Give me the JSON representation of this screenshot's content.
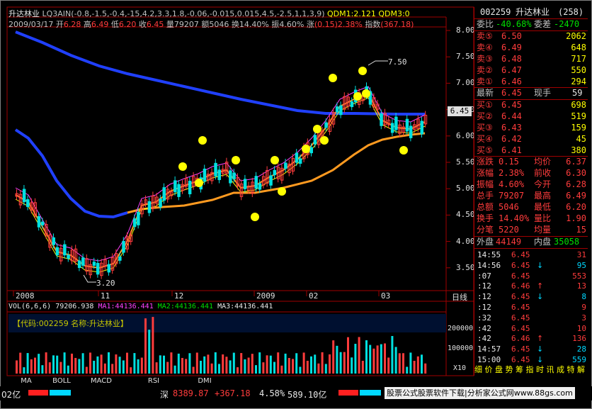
{
  "header": {
    "stock_name": "升达林业",
    "indicator": "LQ3AIN(-0.8,-1.5,-0.4,-15,4.2,3.3,1.8,-0.06,-0.015,0.015,4.5,-2.5,1,1,3,9)",
    "qdm1": "QDM1:2.121",
    "qdm3": "QDM3:0",
    "date": "2009/03/17",
    "open_l": "开",
    "open_v": "6.28",
    "high_l": "高",
    "high_v": "6.49",
    "low_l": "低",
    "low_v": "6.20",
    "close_l": "收",
    "close_v": "6.45",
    "vol_l": "量",
    "vol_v": "79207",
    "amt_l": "额",
    "amt_v": "5046",
    "turn_l": "换",
    "turn_v": "14.40%",
    "amp_l": "振",
    "amp_v": "4.60%",
    "chg_l": "涨",
    "chg_v": "(0.15)2.38%",
    "idx_l": "指数",
    "idx_v": "(367.18)"
  },
  "price_axis": [
    "8.00",
    "7.50",
    "7.00",
    "6.50",
    "6.00",
    "5.50",
    "5.00",
    "4.50",
    "4.00",
    "3.50"
  ],
  "current_price_tag": "6.45",
  "annotations": {
    "high_label": "7.50",
    "low_label": "3.20"
  },
  "time_axis": {
    "labels": [
      "2008",
      "11",
      "12",
      "2009",
      "02",
      "03"
    ],
    "right_label": "日线"
  },
  "volume": {
    "header": "VOL(6,6,6) 79206.938",
    "ma1": "MA1:44136.441",
    "ma2": "MA2:44136.441",
    "ma3": "MA3:44136.441",
    "info_box": "【代码:002259 名称:升达林业】",
    "axis": [
      "200000",
      "100000"
    ],
    "unit": "X10"
  },
  "tabs": [
    "MA",
    "BOLL",
    "MACD",
    "RSI",
    "DMI"
  ],
  "bottom": {
    "left_stub": "02亿",
    "market_label": "深",
    "index_value": "8389.87",
    "index_change": "+367.18",
    "index_pct": "4.58%",
    "index_amount": "589.10亿",
    "ad_text": "股票公式股票软件下载|分析家公式网www.88gs.com"
  },
  "panel": {
    "code": "002259",
    "name": "升达林业",
    "num": "(258)",
    "weibi_l": "委比",
    "weibi_v": "-40.68%",
    "weicha_l": "委差",
    "weicha_v": "-2470",
    "sells": [
      {
        "label": "卖⑤",
        "price": "6.50",
        "vol": "2062"
      },
      {
        "label": "卖④",
        "price": "6.49",
        "vol": "648"
      },
      {
        "label": "卖③",
        "price": "6.48",
        "vol": "717"
      },
      {
        "label": "卖②",
        "price": "6.47",
        "vol": "550"
      },
      {
        "label": "卖①",
        "price": "6.46",
        "vol": "294"
      }
    ],
    "latest_l": "最新",
    "latest_v": "6.45",
    "xianshou_l": "现手",
    "xianshou_v": "59",
    "buys": [
      {
        "label": "买①",
        "price": "6.45",
        "vol": "698"
      },
      {
        "label": "买②",
        "price": "6.44",
        "vol": "519"
      },
      {
        "label": "买③",
        "price": "6.43",
        "vol": "159"
      },
      {
        "label": "买④",
        "price": "6.42",
        "vol": "45"
      },
      {
        "label": "买⑤",
        "price": "6.41",
        "vol": "380"
      }
    ],
    "stats": [
      {
        "l1": "涨跌",
        "v1": "0.15",
        "l2": "均价",
        "v2": "6.37"
      },
      {
        "l1": "涨幅",
        "v1": "2.38%",
        "l2": "前收",
        "v2": "6.30"
      },
      {
        "l1": "振幅",
        "v1": "4.60%",
        "l2": "今开",
        "v2": "6.28"
      },
      {
        "l1": "总手",
        "v1": "79207",
        "l2": "最高",
        "v2": "6.49"
      },
      {
        "l1": "总额",
        "v1": "5046",
        "l2": "最低",
        "v2": "6.20"
      },
      {
        "l1": "换手",
        "v1": "14.40%",
        "l2": "量比",
        "v2": "1.90"
      },
      {
        "l1": "分笔",
        "v1": "5220",
        "l2": "均量",
        "v2": "15"
      }
    ],
    "waipan_l": "外盘",
    "waipan_v": "44149",
    "neipan_l": "内盘",
    "neipan_v": "35058",
    "ticks": [
      {
        "t": "14:55",
        "p": "6.45",
        "a": "",
        "v": "31"
      },
      {
        "t": "14:56",
        "p": "6.45",
        "a": "↓",
        "v": "95"
      },
      {
        "t": ":07",
        "p": "6.45",
        "a": "",
        "v": "553"
      },
      {
        "t": ":12",
        "p": "6.46",
        "a": "↑",
        "v": "13"
      },
      {
        "t": ":12",
        "p": "6.45",
        "a": "↓",
        "v": "8"
      },
      {
        "t": ":12",
        "p": "6.45",
        "a": "",
        "v": "9"
      },
      {
        "t": ":32",
        "p": "6.45",
        "a": "",
        "v": "3"
      },
      {
        "t": ":42",
        "p": "6.45",
        "a": "",
        "v": "10"
      },
      {
        "t": ":42",
        "p": "6.46",
        "a": "↑",
        "v": "136"
      },
      {
        "t": "14:57",
        "p": "6.45",
        "a": "↓",
        "v": "28"
      },
      {
        "t": "15:00",
        "p": "6.45",
        "a": "↓",
        "v": "559"
      }
    ],
    "footer": "细 价 盘 势 筹 指 时 讯 成 特 解"
  },
  "colors": {
    "up": "#ff3c3c",
    "down": "#00e0e0",
    "ma_blue": "#2040ff",
    "ma_orange": "#ff9a20",
    "grid": "#a00000",
    "yellow": "#ffff00",
    "magenta": "#ff40ff"
  },
  "chart_data": {
    "type": "candlestick",
    "price_range": [
      3.2,
      8.2
    ],
    "long_ma_blue": [
      [
        0,
        8.0
      ],
      [
        40,
        7.7
      ],
      [
        90,
        7.3
      ],
      [
        140,
        7.1
      ],
      [
        200,
        6.9
      ],
      [
        260,
        6.75
      ],
      [
        320,
        6.55
      ],
      [
        380,
        6.45
      ],
      [
        430,
        6.42
      ],
      [
        480,
        6.4
      ],
      [
        540,
        6.42
      ],
      [
        600,
        6.4
      ]
    ],
    "short_ma_blue": [
      [
        0,
        6.0
      ],
      [
        30,
        5.75
      ],
      [
        60,
        5.3
      ],
      [
        90,
        4.7
      ],
      [
        120,
        4.4
      ],
      [
        150,
        4.35
      ],
      [
        180,
        4.55
      ]
    ]
  }
}
